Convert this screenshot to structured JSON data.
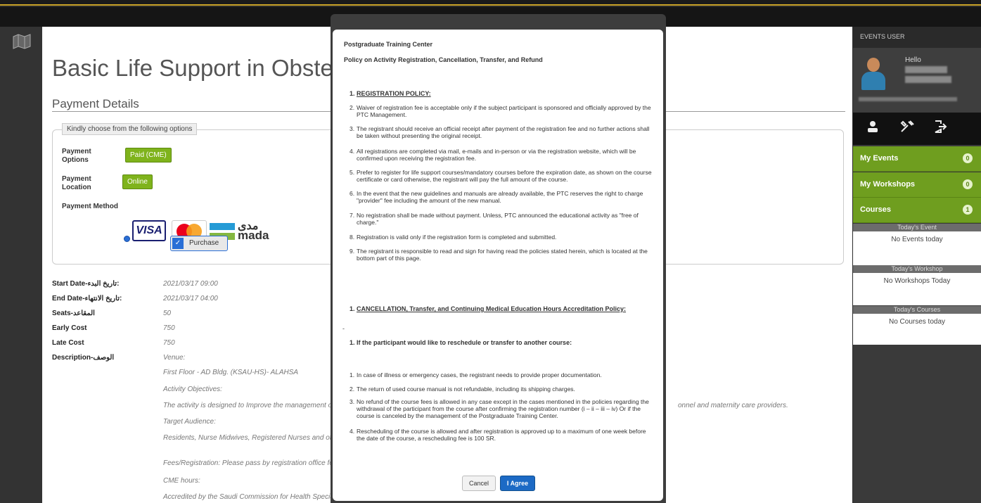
{
  "main": {
    "title": "Basic Life Support in Obstetric",
    "section_title": "Payment Details",
    "options_legend": "Kindly choose from the following options",
    "payment_options_label": "Payment Options",
    "payment_options_value": "Paid (CME)",
    "payment_location_label": "Payment Location",
    "payment_location_value": "Online",
    "payment_method_label": "Payment Method",
    "payment_logos": [
      "VISA",
      "mastercard",
      "mada"
    ],
    "mada_arabic": "مدى",
    "purchase_label": "Purchase",
    "details": [
      {
        "label": "Start Date-تاريخ البدء:",
        "value": "2021/03/17 09:00"
      },
      {
        "label": "End Date-تاريخ الانتهاء:",
        "value": "2021/03/17 04:00"
      },
      {
        "label": "Seats-المقاعد",
        "value": "50"
      },
      {
        "label": "Early Cost",
        "value": "750"
      },
      {
        "label": "Late Cost",
        "value": "750"
      },
      {
        "label": "Description-الوصف",
        "value": "Venue:"
      }
    ],
    "description_lines": [
      "First Floor - AD Bldg. (KSAU-HS)- ALAHSA",
      "Activity Objectives:",
      "The activity is designed to Improve the management of",
      "Target Audience:",
      "Residents, Nurse Midwives, Registered Nurses and othe",
      "Fees/Registration:  Please pass by registration office for",
      "CME hours:",
      "Accredited by the Saudi Commission for Health Special"
    ],
    "description_tail": "onnel and maternity care providers."
  },
  "right_panel": {
    "header": "EVENTS USER",
    "hello": "Hello",
    "menu": [
      {
        "label": "My Events",
        "count": "0"
      },
      {
        "label": "My Workshops",
        "count": "0"
      },
      {
        "label": "Courses",
        "count": "1"
      }
    ],
    "sections": [
      {
        "head": "Today's Event",
        "body": "No Events today"
      },
      {
        "head": "Today's Workshop",
        "body": "No Workshops Today"
      },
      {
        "head": "Today's Courses",
        "body": "No Courses today"
      }
    ]
  },
  "modal": {
    "org": "Postgraduate Training Center",
    "policy_title": "Policy on Activity Registration, Cancellation, Transfer, and Refund",
    "reg_heading": "REGISTRATION POLICY:",
    "reg_items": [
      "Waiver of registration fee is acceptable only if the subject participant is sponsored and officially approved by the PTC Management.",
      "The registrant should receive an official receipt after payment of the registration fee and no further actions shall be taken without presenting the original receipt.",
      "All registrations are completed via mail, e-mails and in-person or via the registration website, which will be confirmed upon receiving the registration fee.",
      "Prefer to register for life support courses/mandatory courses before the expiration date, as shown on the course certificate or card otherwise, the registrant will pay the full amount of the course.",
      "In the event that the new guidelines and manuals are already available, the PTC reserves the right to charge \"provider\" fee including the amount of the new manual.",
      "No registration shall be made without payment. Unless, PTC announced the educational activity as \"free of charge.\"",
      "Registration is valid only if the registration form is completed and submitted.",
      "The registrant is responsible to read and sign for having read the policies stated herein, which is located at the bottom part of this page."
    ],
    "cancel_heading": "CANCELLATION, Transfer, and Continuing Medical Education Hours Accreditation Policy:",
    "dash": "-",
    "reschedule_heading": "If the participant would like to reschedule or transfer to another course:",
    "cancel_items": [
      "In case of illness or emergency cases, the registrant needs to provide proper documentation.",
      "The return of used course manual is not refundable, including its shipping charges.",
      "No refund of the course fees is allowed in any case except in the cases mentioned in the policies regarding the withdrawal of the participant from the course after confirming the registration number (i – ii – iii – iv) Or if the course is canceled by the management of the Postgraduate Training Center.",
      "Rescheduling of the course is allowed and after registration is approved up to a maximum of one week before the date of the course, a rescheduling fee is 100 SR."
    ],
    "cancel_button": "Cancel",
    "agree_button": "I Agree"
  },
  "colors": {
    "green": "#7fb31c",
    "blue": "#1c6ac5",
    "dark": "#2b2b2b"
  }
}
